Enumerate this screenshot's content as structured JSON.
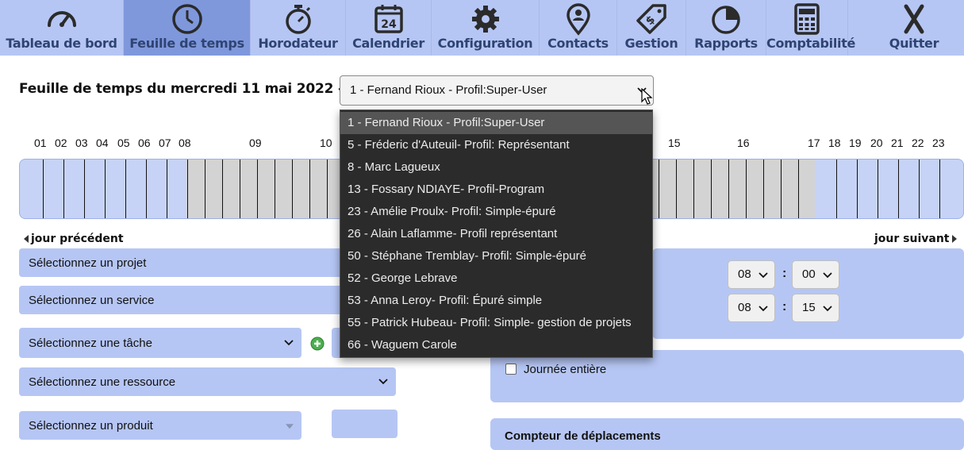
{
  "nav": {
    "items": [
      {
        "label": "Tableau de bord",
        "icon": "gauge-icon"
      },
      {
        "label": "Feuille de temps",
        "icon": "clock-icon"
      },
      {
        "label": "Horodateur",
        "icon": "stopwatch-icon"
      },
      {
        "label": "Calendrier",
        "icon": "calendar-icon",
        "day": "24"
      },
      {
        "label": "Configuration",
        "icon": "gear-icon"
      },
      {
        "label": "Contacts",
        "icon": "map-pin-user-icon"
      },
      {
        "label": "Gestion",
        "icon": "price-tag-icon"
      },
      {
        "label": "Rapports",
        "icon": "pie-chart-icon"
      },
      {
        "label": "Comptabilité",
        "icon": "calculator-icon"
      },
      {
        "label": "Quitter",
        "icon": "close-icon"
      }
    ],
    "active_index": 1,
    "colors": {
      "bar": "#b6c6f4",
      "active": "#7f98dc",
      "label": "#2f4472"
    }
  },
  "header": {
    "title": "Feuille de temps du mercredi 11 mai 2022 -",
    "user_select_value": "1 - Fernand Rioux - Profil:Super-User"
  },
  "timeline": {
    "hours": [
      "01",
      "02",
      "03",
      "04",
      "05",
      "06",
      "07",
      "08",
      "09",
      "10",
      "15",
      "16",
      "17",
      "18",
      "19",
      "20",
      "21",
      "22",
      "23"
    ],
    "prev_day": "jour précédent",
    "next_day": "jour suivant"
  },
  "form": {
    "project": "Sélectionnez un projet",
    "service": "Sélectionnez un service",
    "task": "Sélectionnez une tâche",
    "resource": "Sélectionnez une ressource",
    "product": "Sélectionnez un produit",
    "start_hour": "08",
    "start_minute": "00",
    "end_hour": "08",
    "end_minute": "15",
    "colon": ":",
    "full_day": "Journée entière",
    "counter_title": "Compteur de déplacements"
  },
  "dropdown": {
    "options": [
      "1 - Fernand Rioux - Profil:Super-User",
      "5 - Fréderic d'Auteuil- Profil: Représentant",
      "8 - Marc Lagueux",
      "13 - Fossary NDIAYE- Profil-Program",
      "23 - Amélie Proulx- Profil: Simple-épuré",
      "26 - Alain Laflamme- Profil représentant",
      "50 - Stéphane Tremblay- Profil: Simple-épuré",
      "52 - George Lebrave",
      "53 - Anna Leroy- Profil: Épuré simple",
      "55 - Patrick Hubeau- Profil: Simple- gestion de projets",
      "66 - Waguem Carole"
    ],
    "selected_index": 0
  }
}
